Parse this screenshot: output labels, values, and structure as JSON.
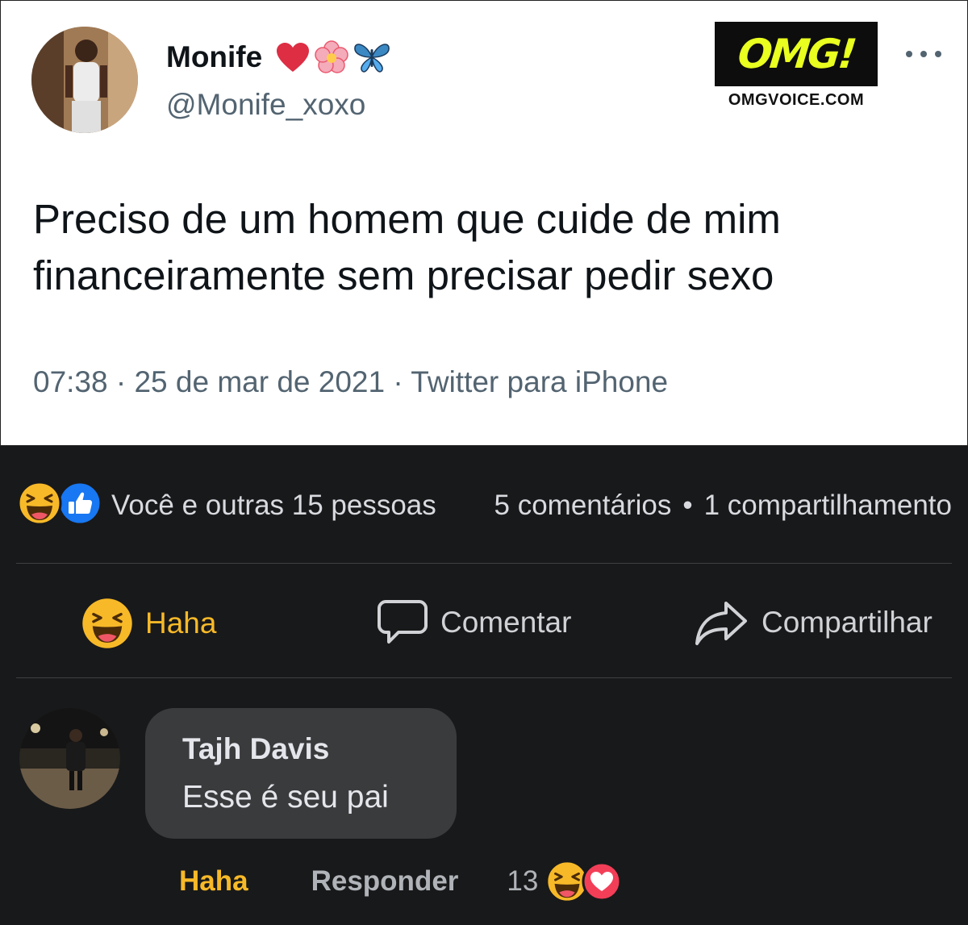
{
  "tweet": {
    "display_name": "Monife",
    "handle": "@Monife_xoxo",
    "name_emojis": [
      "heart-icon",
      "blossom-icon",
      "butterfly-icon"
    ],
    "text": "Preciso de um homem que cuide de mim financeiramente sem precisar pedir sexo",
    "meta": "07:38 · 25 de mar de 2021 · Twitter para iPhone"
  },
  "watermark": {
    "logo_text": "OMG!",
    "site": "OMGVOICE.COM",
    "logo_color": "#e9ff1f"
  },
  "post": {
    "reactions_text": "Você e outras 15 pessoas",
    "comments_count": "5 comentários",
    "separator": "•",
    "shares_count": "1 compartilhamento",
    "reaction_icons": [
      "haha-emoji-icon",
      "like-icon"
    ]
  },
  "actions": {
    "haha_label": "Haha",
    "comment_label": "Comentar",
    "share_label": "Compartilhar"
  },
  "comment": {
    "author": "Tajh Davis",
    "text": "Esse é seu pai",
    "haha_label": "Haha",
    "reply_label": "Responder",
    "reaction_count": "13",
    "reaction_icons": [
      "haha-emoji-icon",
      "love-icon"
    ]
  },
  "colors": {
    "fb_background": "#18191a",
    "haha_yellow": "#f7b928",
    "like_blue": "#1877f2",
    "love_red": "#f33e58"
  }
}
